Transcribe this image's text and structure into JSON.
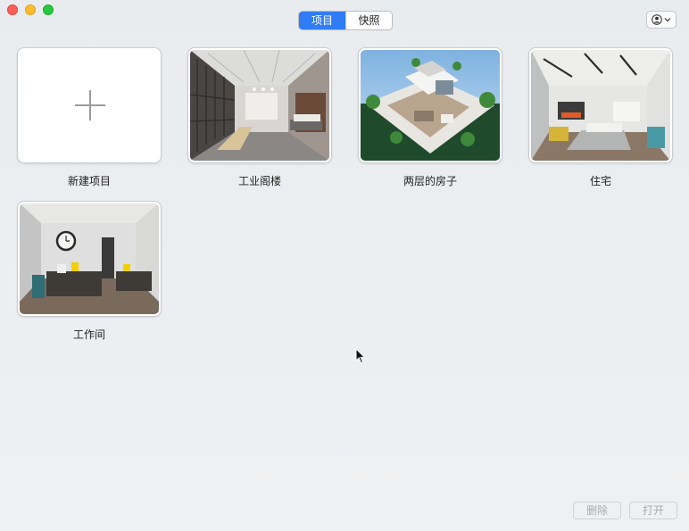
{
  "toolbar": {
    "tabs": [
      {
        "label": "项目",
        "active": true
      },
      {
        "label": "快照",
        "active": false
      }
    ]
  },
  "projects": [
    {
      "label": "新建项目",
      "kind": "new"
    },
    {
      "label": "工业阁楼",
      "kind": "loft"
    },
    {
      "label": "两层的房子",
      "kind": "house"
    },
    {
      "label": "住宅",
      "kind": "residence"
    },
    {
      "label": "工作间",
      "kind": "office"
    }
  ],
  "footer": {
    "delete_label": "删除",
    "open_label": "打开"
  },
  "colors": {
    "accent": "#2f7cf6",
    "close": "#fe5f57",
    "minimize": "#febc2e",
    "zoom": "#28c840"
  }
}
